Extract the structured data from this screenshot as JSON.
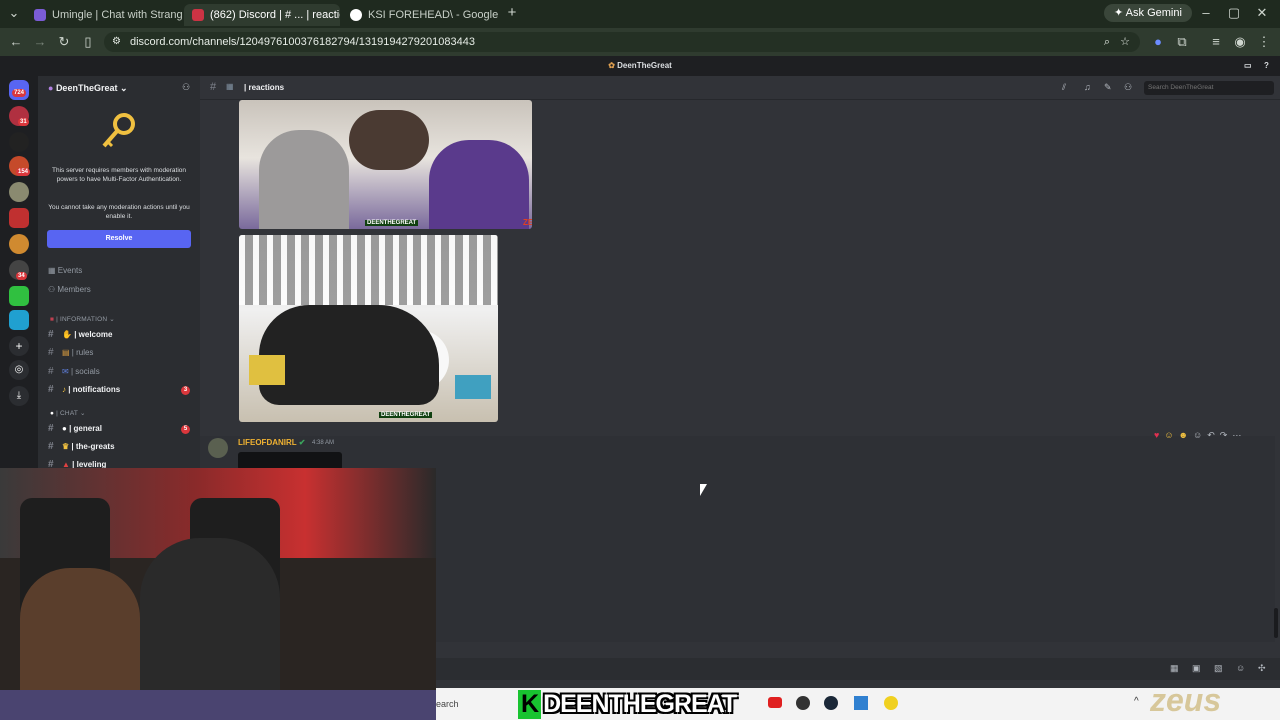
{
  "browser": {
    "tabs": [
      {
        "title": "Umingle | Chat with Strangers N",
        "color": "#7b5cd6"
      },
      {
        "title": "(862) Discord | # ... | reactions",
        "color": "#cc3344"
      },
      {
        "title": "KSI FOREHEAD\\ - Google Search",
        "color": "#ffffff"
      }
    ],
    "url": "discord.com/channels/1204976100376182794/1319194279201083443",
    "ask_gemini": "Ask Gemini"
  },
  "discord": {
    "window_title": "DeenTheGreat",
    "rail_badges": [
      "724",
      "31",
      "154",
      "34"
    ],
    "guild_name": "DeenTheGreat",
    "mfa": {
      "line1": "This server requires members with moderation powers to have Multi-Factor Authentication.",
      "line2": "You cannot take any moderation actions until you enable it.",
      "resolve_label": "Resolve"
    },
    "nav": {
      "events": "Events",
      "members": "Members"
    },
    "categories": {
      "information": "| INFORMATION",
      "chat": "| CHAT"
    },
    "channels": [
      {
        "name": "| welcome",
        "badge": ""
      },
      {
        "name": "| rules",
        "badge": ""
      },
      {
        "name": "| socials",
        "badge": ""
      },
      {
        "name": "| notifications",
        "badge": "3"
      },
      {
        "name": "| general",
        "badge": "5"
      },
      {
        "name": "| the-greats",
        "badge": ""
      },
      {
        "name": "| leveling",
        "badge": ""
      }
    ],
    "channel_header": {
      "name": "| reactions",
      "search_placeholder": "Search DeenTheGreat"
    },
    "message": {
      "author": "LIFEOFDANIRL",
      "timestamp": "4:38 AM"
    },
    "image_watermark": "DEENTHEGREAT",
    "image_watermark2": "ZE"
  },
  "overlay": {
    "brand_k": "K",
    "brand_text": "DEENTHEGREAT",
    "watermark": "zeus",
    "taskbar_search": "earch"
  }
}
